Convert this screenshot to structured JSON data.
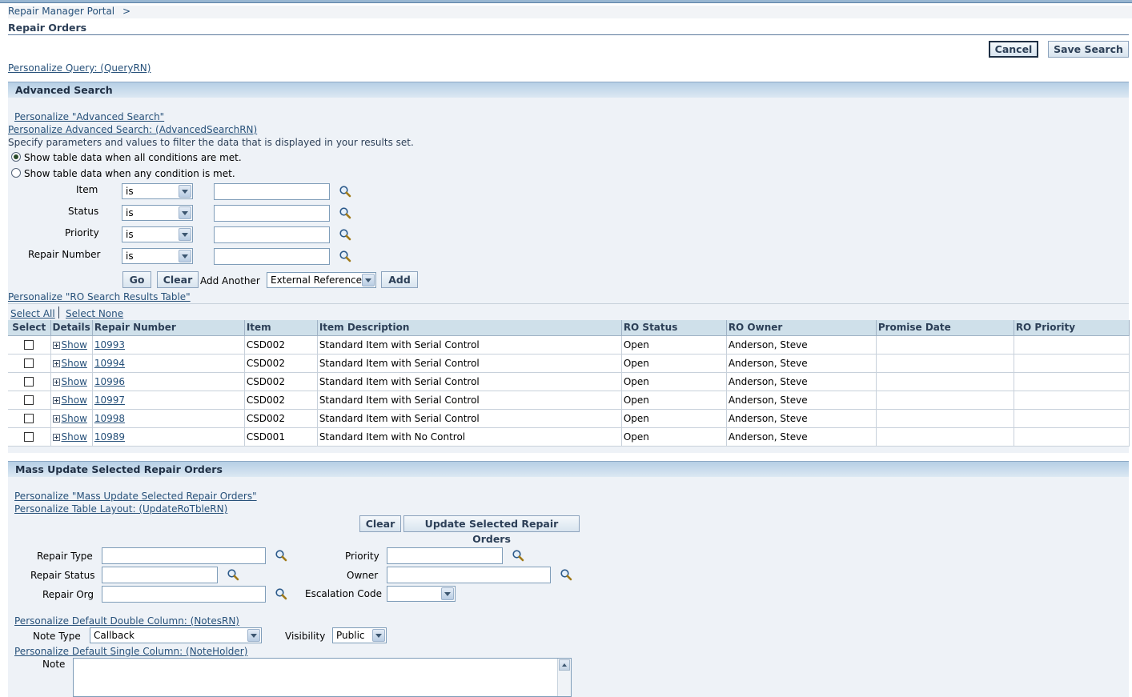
{
  "breadcrumb": {
    "portal": "Repair Manager Portal",
    "separator": ">"
  },
  "page_title": "Repair Orders",
  "top_buttons": {
    "cancel": "Cancel",
    "save_search": "Save Search"
  },
  "personalize_query": "Personalize Query: (QueryRN)",
  "advanced_search": {
    "header": "Advanced Search",
    "personalize_1": "Personalize \"Advanced Search\"",
    "personalize_2": "Personalize Advanced Search: (AdvancedSearchRN)",
    "instructions": "Specify parameters and values to filter the data that is displayed in your results set.",
    "radio_all": "Show table data when all conditions are met.",
    "radio_any": "Show table data when any condition is met.",
    "rows": [
      {
        "label": "Item",
        "operator": "is",
        "value": ""
      },
      {
        "label": "Status",
        "operator": "is",
        "value": ""
      },
      {
        "label": "Priority",
        "operator": "is",
        "value": ""
      },
      {
        "label": "Repair Number",
        "operator": "is",
        "value": ""
      }
    ],
    "go": "Go",
    "clear": "Clear",
    "add_another": "Add Another",
    "add_field": "External Reference",
    "add": "Add"
  },
  "results": {
    "personalize": "Personalize \"RO Search Results Table\"",
    "select_all": "Select All",
    "select_none": "Select None",
    "columns": [
      "Select",
      "Details",
      "Repair Number",
      "Item",
      "Item Description",
      "RO Status",
      "RO Owner",
      "Promise Date",
      "RO Priority"
    ],
    "show_label": "Show",
    "rows": [
      {
        "repair_number": "10993",
        "item": "CSD002",
        "description": "Standard Item with Serial Control",
        "status": "Open",
        "owner": "Anderson, Steve",
        "promise": "",
        "priority": ""
      },
      {
        "repair_number": "10994",
        "item": "CSD002",
        "description": "Standard Item with Serial Control",
        "status": "Open",
        "owner": "Anderson, Steve",
        "promise": "",
        "priority": ""
      },
      {
        "repair_number": "10996",
        "item": "CSD002",
        "description": "Standard Item with Serial Control",
        "status": "Open",
        "owner": "Anderson, Steve",
        "promise": "",
        "priority": ""
      },
      {
        "repair_number": "10997",
        "item": "CSD002",
        "description": "Standard Item with Serial Control",
        "status": "Open",
        "owner": "Anderson, Steve",
        "promise": "",
        "priority": ""
      },
      {
        "repair_number": "10998",
        "item": "CSD002",
        "description": "Standard Item with Serial Control",
        "status": "Open",
        "owner": "Anderson, Steve",
        "promise": "",
        "priority": ""
      },
      {
        "repair_number": "10989",
        "item": "CSD001",
        "description": "Standard Item with No Control",
        "status": "Open",
        "owner": "Anderson, Steve",
        "promise": "",
        "priority": ""
      }
    ]
  },
  "mass_update": {
    "header": "Mass Update Selected Repair Orders",
    "personalize_1": "Personalize \"Mass Update Selected Repair Orders\"",
    "personalize_2": "Personalize Table Layout: (UpdateRoTbleRN)",
    "clear": "Clear",
    "update": "Update Selected Repair Orders",
    "repair_type": "Repair Type",
    "repair_status": "Repair Status",
    "repair_org": "Repair Org",
    "priority": "Priority",
    "owner": "Owner",
    "escalation_code": "Escalation Code",
    "escalation_value": "",
    "personalize_notes": "Personalize Default Double Column: (NotesRN)",
    "note_type_label": "Note Type",
    "note_type_value": "Callback",
    "visibility_label": "Visibility",
    "visibility_value": "Public",
    "personalize_note_holder": "Personalize Default Single Column: (NoteHolder)",
    "note_label": "Note"
  }
}
